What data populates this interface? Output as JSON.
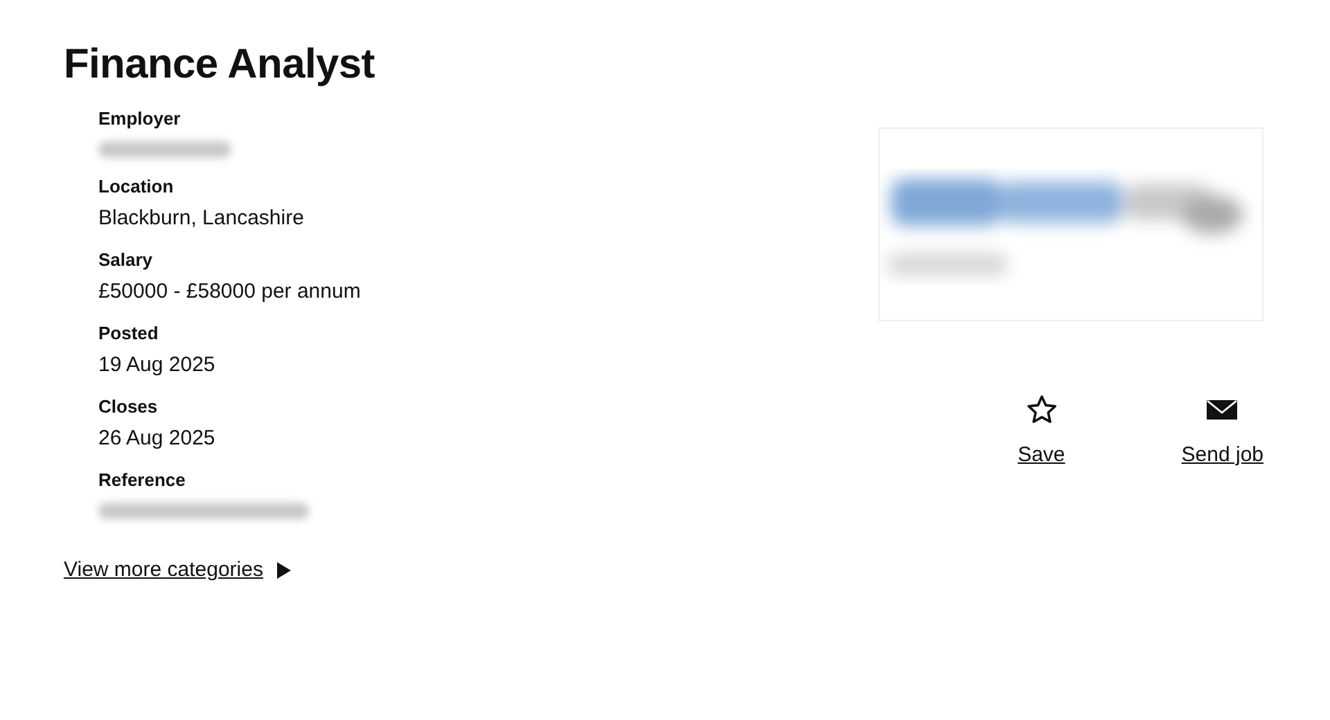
{
  "title": "Finance Analyst",
  "details": [
    {
      "label": "Employer",
      "blurred": true
    },
    {
      "label": "Location",
      "value": "Blackburn, Lancashire",
      "blurred": false
    },
    {
      "label": "Salary",
      "value": "£50000 - £58000 per annum",
      "blurred": false
    },
    {
      "label": "Posted",
      "value": "19 Aug 2025",
      "blurred": false
    },
    {
      "label": "Closes",
      "value": "26 Aug 2025",
      "blurred": false
    },
    {
      "label": "Reference",
      "blurred": true
    }
  ],
  "more_link": {
    "label": "View more categories"
  },
  "actions": [
    {
      "kind": "save",
      "label": "Save"
    },
    {
      "kind": "send",
      "label": "Send job"
    }
  ]
}
